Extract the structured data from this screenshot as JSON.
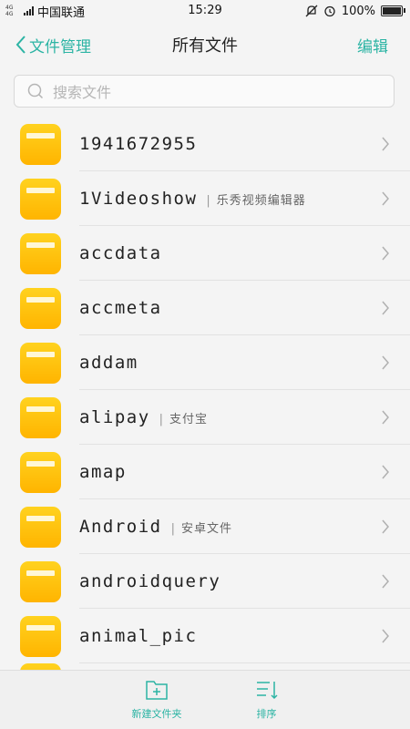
{
  "status_bar": {
    "network": "4G 4G",
    "carrier": "中国联通",
    "time": "15:29",
    "battery": "100%",
    "battery_level": 1.0
  },
  "navbar": {
    "back_label": "文件管理",
    "title": "所有文件",
    "edit_label": "编辑"
  },
  "search": {
    "placeholder": "搜索文件"
  },
  "files": [
    {
      "name": "1941672955",
      "desc": ""
    },
    {
      "name": "1Videoshow",
      "desc": "乐秀视频编辑器"
    },
    {
      "name": "accdata",
      "desc": ""
    },
    {
      "name": "accmeta",
      "desc": ""
    },
    {
      "name": "addam",
      "desc": ""
    },
    {
      "name": "alipay",
      "desc": "支付宝"
    },
    {
      "name": "amap",
      "desc": ""
    },
    {
      "name": "Android",
      "desc": "安卓文件"
    },
    {
      "name": "androidquery",
      "desc": ""
    },
    {
      "name": "animal_pic",
      "desc": ""
    }
  ],
  "bottom_bar": {
    "new_folder_label": "新建文件夹",
    "sort_label": "排序"
  },
  "colors": {
    "accent": "#2cb4a4",
    "folder": "#ffc20e"
  }
}
